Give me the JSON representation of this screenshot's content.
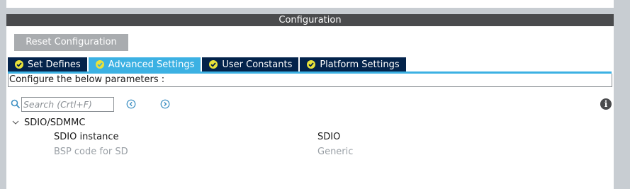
{
  "panel": {
    "title": "Configuration"
  },
  "toolbar": {
    "reset_label": "Reset Configuration"
  },
  "tabs": [
    {
      "label": "Set Defines",
      "active": false
    },
    {
      "label": "Advanced Settings",
      "active": true
    },
    {
      "label": "User Constants",
      "active": false
    },
    {
      "label": "Platform Settings",
      "active": false
    }
  ],
  "description": "Configure the below parameters :",
  "search": {
    "placeholder": "Search (Crtl+F)"
  },
  "tree": {
    "group_label": "SDIO/SDMMC",
    "params": [
      {
        "name": "SDIO instance",
        "value": "SDIO",
        "enabled": true
      },
      {
        "name": "BSP code for SD",
        "value": "Generic",
        "enabled": false
      }
    ]
  },
  "colors": {
    "header_bg": "#4a4b4d",
    "tab_bg": "#03234b",
    "tab_active_bg": "#3cb1e3",
    "check_badge": "#e8e23a",
    "button_bg": "#a9acaf"
  }
}
